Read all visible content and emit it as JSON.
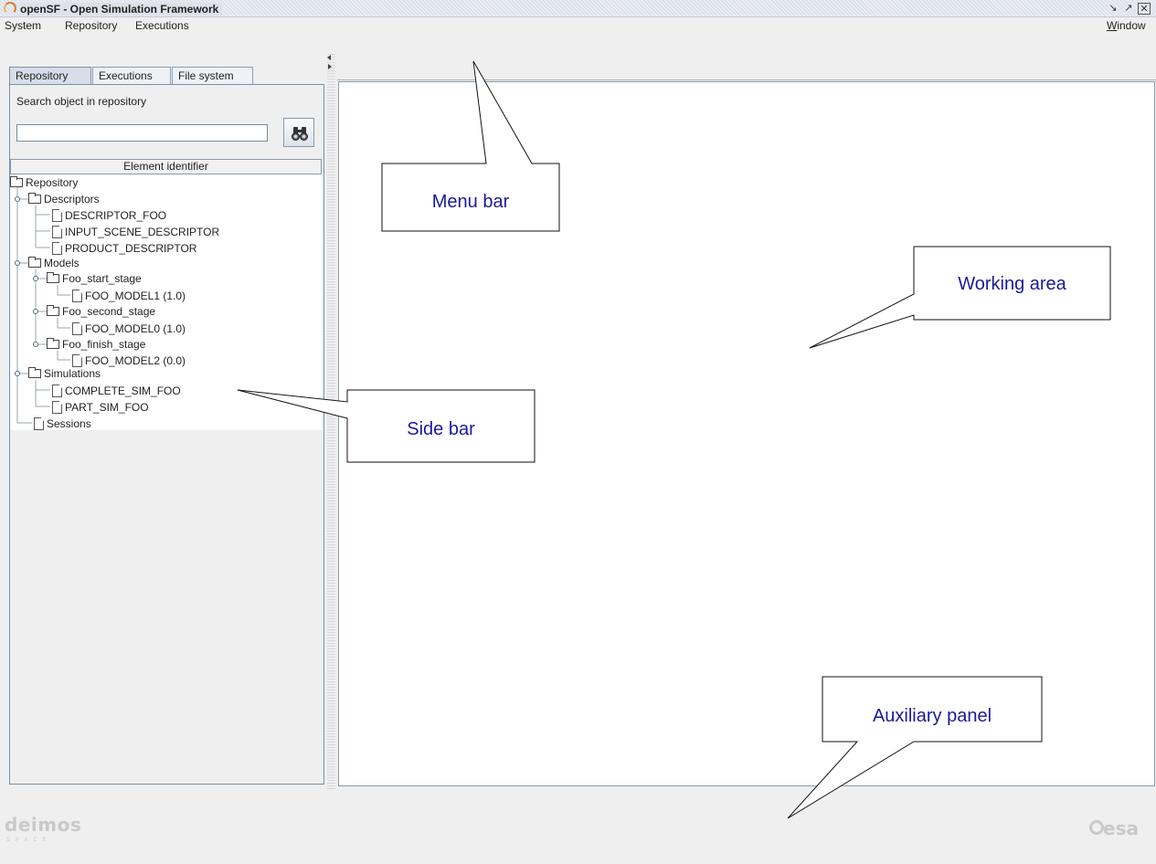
{
  "window": {
    "title": "openSF - Open Simulation Framework",
    "controls": {
      "minimize": "↘",
      "maximize": "↗",
      "close": "✕"
    }
  },
  "menubar": {
    "items": [
      "System",
      "Repository",
      "Executions"
    ],
    "right": "Window"
  },
  "sidebar": {
    "tabs": [
      "Repository",
      "Executions",
      "File system"
    ],
    "active_tab": "Repository",
    "search_label": "Search object in repository",
    "search_value": "",
    "column_header": "Element identifier",
    "tree": {
      "root": "Repository",
      "descriptors": "Descriptors",
      "descriptor_items": [
        "DESCRIPTOR_FOO",
        "INPUT_SCENE_DESCRIPTOR",
        "PRODUCT_DESCRIPTOR"
      ],
      "models": "Models",
      "model_stages": [
        {
          "stage": "Foo_start_stage",
          "model": "FOO_MODEL1 (1.0)"
        },
        {
          "stage": "Foo_second_stage",
          "model": "FOO_MODEL0 (1.0)"
        },
        {
          "stage": "Foo_finish_stage",
          "model": "FOO_MODEL2 (0.0)"
        }
      ],
      "simulations": "Simulations",
      "simulation_items": [
        "COMPLETE_SIM_FOO",
        "PART_SIM_FOO"
      ],
      "sessions": "Sessions"
    }
  },
  "callouts": {
    "menu_bar": "Menu bar",
    "working_area": "Working area",
    "side_bar": "Side bar",
    "auxiliary_panel": "Auxiliary panel"
  },
  "logos": {
    "left": "deimos",
    "left_sub": "SPACE",
    "right": "esa"
  },
  "colors": {
    "callout_text": "#1a1a9a",
    "tab_border": "#7890aa",
    "title_bar": "#dde2ea"
  }
}
